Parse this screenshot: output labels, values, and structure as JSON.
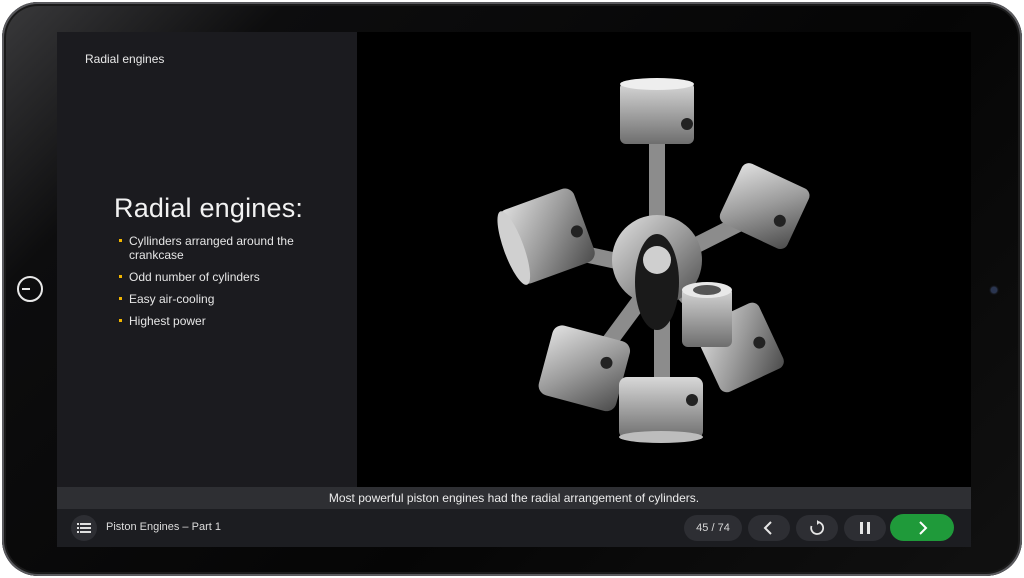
{
  "slide": {
    "title": "Radial engines",
    "heading": "Radial engines:",
    "bullets": [
      "Cyllinders arranged around the crankcase",
      "Odd number of cylinders",
      "Easy air-cooling",
      "Highest power"
    ],
    "image": "radial-engine-pistons",
    "caption": "Most powerful piston engines had the radial arrangement of cylinders."
  },
  "player": {
    "course_title": "Piston Engines – Part 1",
    "progress": "45 / 74",
    "icons": {
      "menu": "list-icon",
      "prev": "chevron-left-icon",
      "replay": "replay-icon",
      "pause": "pause-icon",
      "next": "chevron-right-icon"
    },
    "colors": {
      "accent_bullet": "#f2b600",
      "next_button": "#1f9a3a",
      "panel": "#1b1b1f"
    }
  }
}
